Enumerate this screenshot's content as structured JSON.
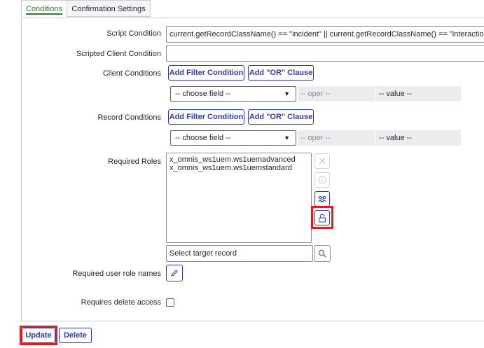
{
  "tabs": [
    {
      "label": "Conditions"
    },
    {
      "label": "Confirmation Settings"
    }
  ],
  "form": {
    "script_condition_label": "Script Condition",
    "script_condition_value": "current.getRecordClassName() == \"incident\" || current.getRecordClassName() == \"interaction\" || current.getRecordClassName() == \"",
    "scripted_client_condition_label": "Scripted Client Condition",
    "scripted_client_condition_value": "",
    "client_conditions_label": "Client Conditions",
    "record_conditions_label": "Record Conditions",
    "add_filter_label": "Add Filter Condition",
    "add_or_label": "Add \"OR\" Clause",
    "choose_field": "-- choose field --",
    "oper": "-- oper --",
    "value": "-- value --",
    "required_roles_label": "Required Roles",
    "required_roles": [
      "x_omnis_ws1uem.ws1uemadvanced",
      "x_omnis_ws1uem.ws1uemstandard"
    ],
    "select_target_placeholder": "Select target record",
    "required_user_role_names_label": "Required user role names",
    "requires_delete_access_label": "Requires delete access"
  },
  "actions": {
    "update_label": "Update",
    "delete_label": "Delete"
  },
  "colors": {
    "accent": "#2f3bb5",
    "tab_active": "#2e7d32",
    "highlight": "#e11d1d"
  }
}
